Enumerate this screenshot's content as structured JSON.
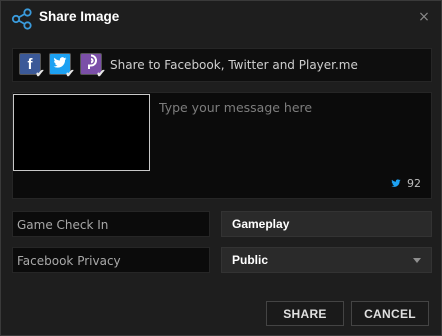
{
  "window": {
    "title": "Share Image",
    "close_glyph": "×",
    "icon": "share-icon"
  },
  "share": {
    "label": "Share to Facebook, Twitter and Player.me",
    "services": [
      {
        "name": "Facebook",
        "glyph": "f",
        "icon": "facebook-icon",
        "checked": true,
        "color": "#3b5998"
      },
      {
        "name": "Twitter",
        "glyph": "t",
        "icon": "twitter-icon",
        "checked": true,
        "color": "#1da1f2"
      },
      {
        "name": "Player.me",
        "glyph": "P",
        "icon": "playerme-icon",
        "checked": true,
        "color": "#7b4fa8"
      }
    ]
  },
  "message": {
    "placeholder": "Type your message here",
    "value": "",
    "char_count": "92",
    "counter_icon": "twitter-bird-icon"
  },
  "fields": {
    "check_in": {
      "label": "Game Check In",
      "value": "Gameplay"
    },
    "privacy": {
      "label": "Facebook Privacy",
      "value": "Public"
    }
  },
  "buttons": {
    "share": "SHARE",
    "cancel": "CANCEL"
  }
}
